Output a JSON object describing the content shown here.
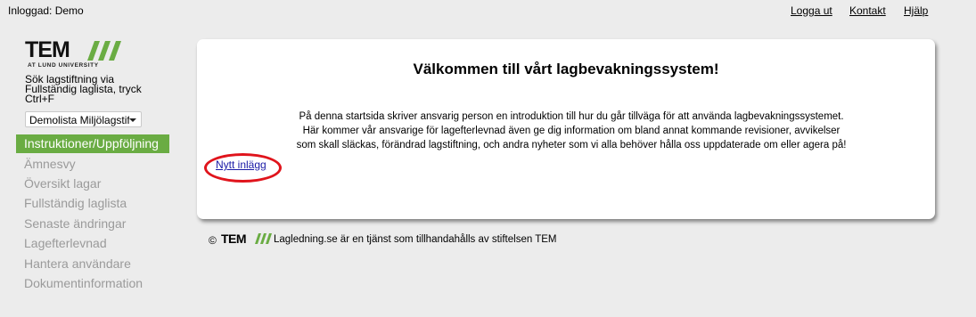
{
  "topbar": {
    "user_label": "Inloggad: Demo",
    "links": [
      {
        "label": "Logga ut"
      },
      {
        "label": "Kontakt"
      },
      {
        "label": "Hjälp"
      }
    ]
  },
  "logo": {
    "name": "TEM",
    "subtitle": "AT LUND UNIVERSITY",
    "accent_color": "#6aac43"
  },
  "sidebar": {
    "search_hint": "Sök lagstiftning via Fullständig laglista, tryck Ctrl+F",
    "select_value": "Demolista Miljölagstiftning",
    "active_item": "Instruktioner/Uppföljning",
    "items": [
      "Ämnesvy",
      "Översikt lagar",
      "Fullständig laglista",
      "Senaste ändringar",
      "Lagefterlevnad",
      "Hantera användare",
      "Dokumentinformation"
    ]
  },
  "main": {
    "title": "Välkommen till vårt lagbevakningssystem!",
    "intro_lines": [
      "På denna startsida skriver ansvarig person en introduktion till hur du går tillväga för att använda lagbevakningssystemet.",
      "Här kommer vår ansvarige för lagefterlevnad även ge dig information om bland annat kommande revisioner, avvikelser",
      "som skall släckas, förändrad lagstiftning, och andra nyheter som vi alla behöver hålla oss uppdaterade om eller agera på!"
    ],
    "new_post_link": "Nytt inlägg",
    "highlight_color": "#e0141c"
  },
  "footer": {
    "copyright": "©",
    "brand": "TEM",
    "text": "Lagledning.se är en tjänst som tillhandahålls av stiftelsen TEM"
  }
}
